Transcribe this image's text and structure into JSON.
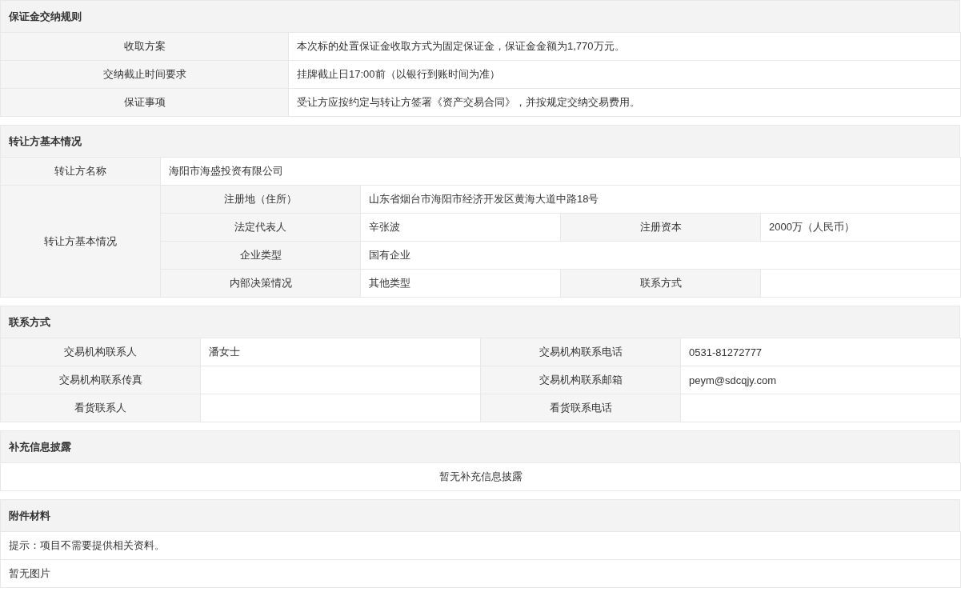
{
  "sections": [
    {
      "title": "保证金交纳规则",
      "rows": [
        [
          {
            "kind": "label",
            "text": "收取方案"
          },
          {
            "kind": "value",
            "text": "本次标的处置保证金收取方式为固定保证金，保证金金额为1,770万元。"
          }
        ],
        [
          {
            "kind": "label",
            "text": "交纳截止时间要求"
          },
          {
            "kind": "value",
            "text": "挂牌截止日17:00前（以银行到账时间为准）"
          }
        ],
        [
          {
            "kind": "label",
            "text": "保证事项"
          },
          {
            "kind": "value",
            "text": "受让方应按约定与转让方签署《资产交易合同》，并按规定交纳交易费用。"
          }
        ]
      ]
    },
    {
      "title": "转让方基本情况",
      "rows": [
        [
          {
            "kind": "label",
            "text": "转让方名称"
          },
          {
            "kind": "value",
            "text": "海阳市海盛投资有限公司",
            "colspan": 4
          }
        ],
        [
          {
            "kind": "label",
            "text": "转让方基本情况",
            "rowspan": 4
          },
          {
            "kind": "label",
            "text": "注册地（住所）"
          },
          {
            "kind": "value",
            "text": "山东省烟台市海阳市经济开发区黄海大道中路18号",
            "colspan": 3
          }
        ],
        [
          {
            "kind": "label",
            "text": "法定代表人"
          },
          {
            "kind": "value",
            "text": "辛张波"
          },
          {
            "kind": "label",
            "text": "注册资本"
          },
          {
            "kind": "value",
            "text": "2000万（人民币）"
          }
        ],
        [
          {
            "kind": "label",
            "text": "企业类型"
          },
          {
            "kind": "value",
            "text": "国有企业",
            "colspan": 3
          }
        ],
        [
          {
            "kind": "label",
            "text": "内部决策情况"
          },
          {
            "kind": "value",
            "text": "其他类型"
          },
          {
            "kind": "label",
            "text": "联系方式"
          },
          {
            "kind": "value"
          }
        ]
      ]
    },
    {
      "title": "联系方式",
      "rows": [
        [
          {
            "kind": "label",
            "text": "交易机构联系人"
          },
          {
            "kind": "value",
            "text": "潘女士"
          },
          {
            "kind": "label",
            "text": "交易机构联系电话"
          },
          {
            "kind": "value",
            "text": "0531-81272777"
          }
        ],
        [
          {
            "kind": "label",
            "text": "交易机构联系传真"
          },
          {
            "kind": "value"
          },
          {
            "kind": "label",
            "text": "交易机构联系邮箱"
          },
          {
            "kind": "value",
            "text": "peym@sdcqjy.com"
          }
        ],
        [
          {
            "kind": "label",
            "text": "看货联系人"
          },
          {
            "kind": "value"
          },
          {
            "kind": "label",
            "text": "看货联系电话"
          },
          {
            "kind": "value"
          }
        ]
      ]
    },
    {
      "title": "补充信息披露",
      "rows": [
        [
          {
            "kind": "notice",
            "text": "暂无补充信息披露"
          }
        ]
      ]
    },
    {
      "title": "附件材料",
      "rows": [
        [
          {
            "kind": "value",
            "text": "提示：项目不需要提供相关资料。"
          }
        ],
        [
          {
            "kind": "value",
            "text": "暂无图片"
          }
        ]
      ]
    }
  ]
}
